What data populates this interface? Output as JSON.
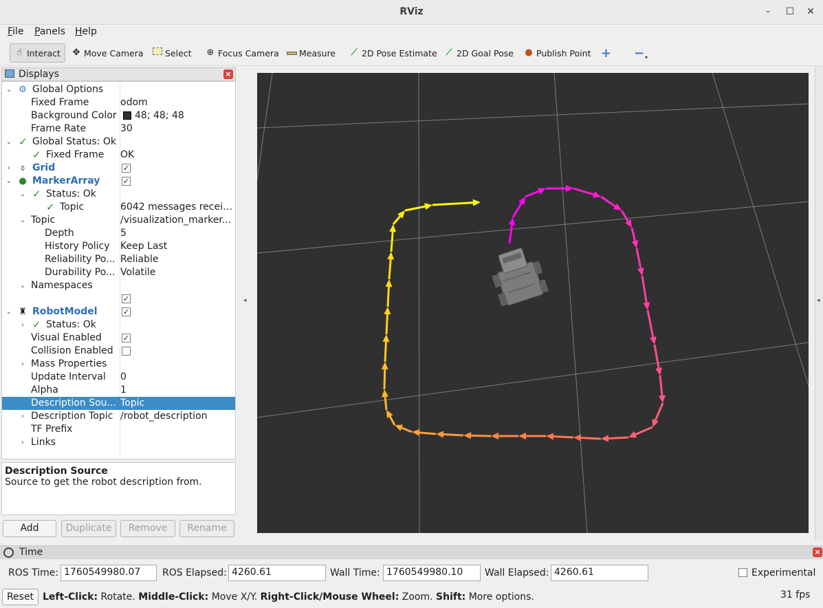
{
  "window": {
    "title": "RViz"
  },
  "menu": [
    "File",
    "Panels",
    "Help"
  ],
  "toolbar": {
    "interact": "Interact",
    "move_camera": "Move Camera",
    "select": "Select",
    "focus_camera": "Focus Camera",
    "measure": "Measure",
    "pose_estimate": "2D Pose Estimate",
    "goal_pose": "2D Goal Pose",
    "publish_point": "Publish Point"
  },
  "displays": {
    "title": "Displays",
    "rows": [
      {
        "name": "Global Options",
        "value": ""
      },
      {
        "name": "Fixed Frame",
        "value": "odom"
      },
      {
        "name": "Background Color",
        "value": "48; 48; 48"
      },
      {
        "name": "Frame Rate",
        "value": "30"
      },
      {
        "name": "Global Status: Ok",
        "value": ""
      },
      {
        "name": "Fixed Frame",
        "value": "OK"
      },
      {
        "name": "Grid",
        "value": ""
      },
      {
        "name": "MarkerArray",
        "value": ""
      },
      {
        "name": "Status: Ok",
        "value": ""
      },
      {
        "name": "Topic",
        "value": "6042 messages receiv..."
      },
      {
        "name": "Topic",
        "value": "/visualization_marker..."
      },
      {
        "name": "Depth",
        "value": "5"
      },
      {
        "name": "History Policy",
        "value": "Keep Last"
      },
      {
        "name": "Reliability Po...",
        "value": "Reliable"
      },
      {
        "name": "Durability Po...",
        "value": "Volatile"
      },
      {
        "name": "Namespaces",
        "value": ""
      },
      {
        "name": "",
        "value": ""
      },
      {
        "name": "RobotModel",
        "value": ""
      },
      {
        "name": "Status: Ok",
        "value": ""
      },
      {
        "name": "Visual Enabled",
        "value": ""
      },
      {
        "name": "Collision Enabled",
        "value": ""
      },
      {
        "name": "Mass Properties",
        "value": ""
      },
      {
        "name": "Update Interval",
        "value": "0"
      },
      {
        "name": "Alpha",
        "value": "1"
      },
      {
        "name": "Description Sou...",
        "value": "Topic"
      },
      {
        "name": "Description Topic",
        "value": "/robot_description"
      },
      {
        "name": "TF Prefix",
        "value": ""
      },
      {
        "name": "Links",
        "value": ""
      }
    ],
    "checkboxes": {
      "grid": true,
      "marker_array": true,
      "namespace": true,
      "robot_model": true,
      "visual_enabled": true,
      "collision_enabled": false
    },
    "background_color": "#303030",
    "description": {
      "heading": "Description Source",
      "text": "Source to get the robot description from."
    },
    "buttons": {
      "add": "Add",
      "duplicate": "Duplicate",
      "remove": "Remove",
      "rename": "Rename"
    }
  },
  "time": {
    "title": "Time",
    "ros_time_label": "ROS Time:",
    "ros_time": "1760549980.07",
    "ros_elapsed_label": "ROS Elapsed:",
    "ros_elapsed": "4260.61",
    "wall_time_label": "Wall Time:",
    "wall_time": "1760549980.10",
    "wall_elapsed_label": "Wall Elapsed:",
    "wall_elapsed": "4260.61",
    "experimental_label": "Experimental",
    "experimental_checked": false
  },
  "status": {
    "reset": "Reset",
    "hint_parts": [
      {
        "b": "Left-Click:",
        "t": " Rotate. "
      },
      {
        "b": "Middle-Click:",
        "t": " Move X/Y. "
      },
      {
        "b": "Right-Click/Mouse Wheel:",
        "t": " Zoom. "
      },
      {
        "b": "Shift:",
        "t": " More options."
      }
    ],
    "fps": "31 fps"
  },
  "colors": {
    "selection": "#3d8cc7",
    "link_blue": "#2a6fb6",
    "arrow_start": "#ff00ff",
    "arrow_end": "#ffff00"
  }
}
